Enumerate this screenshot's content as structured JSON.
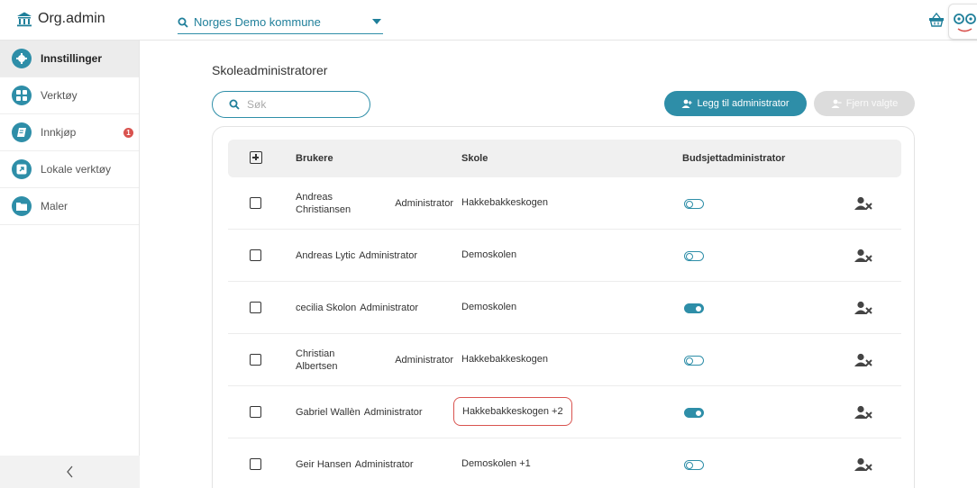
{
  "app": {
    "title": "Org.admin"
  },
  "header": {
    "org_selector": "Norges Demo kommune"
  },
  "sidebar": {
    "items": [
      {
        "label": "Innstillinger",
        "icon": "gear-icon",
        "active": true
      },
      {
        "label": "Verktøy",
        "icon": "grid-icon",
        "active": false
      },
      {
        "label": "Innkjøp",
        "icon": "book-icon",
        "active": false,
        "badge": "1"
      },
      {
        "label": "Lokale verktøy",
        "icon": "external-link-icon",
        "active": false
      },
      {
        "label": "Maler",
        "icon": "folder-icon",
        "active": false
      }
    ],
    "collapse_glyph": "‹"
  },
  "main": {
    "title": "Skoleadministratorer",
    "search_placeholder": "Søk",
    "add_button": "Legg til administrator",
    "remove_button": "Fjern valgte",
    "columns": {
      "users": "Brukere",
      "school": "Skole",
      "budget_admin": "Budsjettadministrator"
    },
    "rows": [
      {
        "name": "Andreas Christiansen",
        "role": "Administrator",
        "school": "Hakkebakkeskogen",
        "budget_admin": false
      },
      {
        "name": "Andreas Lytic",
        "role": "Administrator",
        "school": "Demoskolen",
        "budget_admin": false
      },
      {
        "name": "cecilia Skolon",
        "role": "Administrator",
        "school": "Demoskolen",
        "budget_admin": true
      },
      {
        "name": "Christian Albertsen",
        "role": "Administrator",
        "school": "Hakkebakkeskogen",
        "budget_admin": false
      },
      {
        "name": "Gabriel Wallèn",
        "role": "Administrator",
        "school": "Hakkebakkeskogen +2",
        "budget_admin": true
      },
      {
        "name": "Geir Hansen",
        "role": "Administrator",
        "school": "Demoskolen +1",
        "budget_admin": false
      }
    ]
  },
  "colors": {
    "accent": "#2e8ea8",
    "badge": "#d9534f",
    "highlight": "#d9534f"
  }
}
